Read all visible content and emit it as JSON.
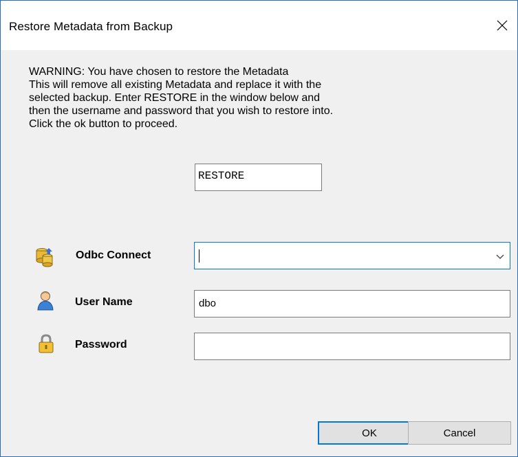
{
  "dialog": {
    "title": "Restore Metadata from Backup"
  },
  "warning": {
    "lines": [
      "WARNING: You have chosen to restore the Metadata",
      "This will remove all existing Metadata and replace it with the",
      "selected backup. Enter RESTORE in the window below and",
      "then the username and password that you wish to restore into.",
      "Click the ok button to proceed."
    ]
  },
  "restore_input": {
    "value": "RESTORE"
  },
  "form": {
    "odbc": {
      "label": "Odbc Connect",
      "value": ""
    },
    "username": {
      "label": "User Name",
      "value": "dbo"
    },
    "password": {
      "label": "Password",
      "value": ""
    }
  },
  "buttons": {
    "ok": "OK",
    "cancel": "Cancel"
  },
  "colors": {
    "accent": "#0078d7",
    "window_border": "#2b6cb5"
  }
}
